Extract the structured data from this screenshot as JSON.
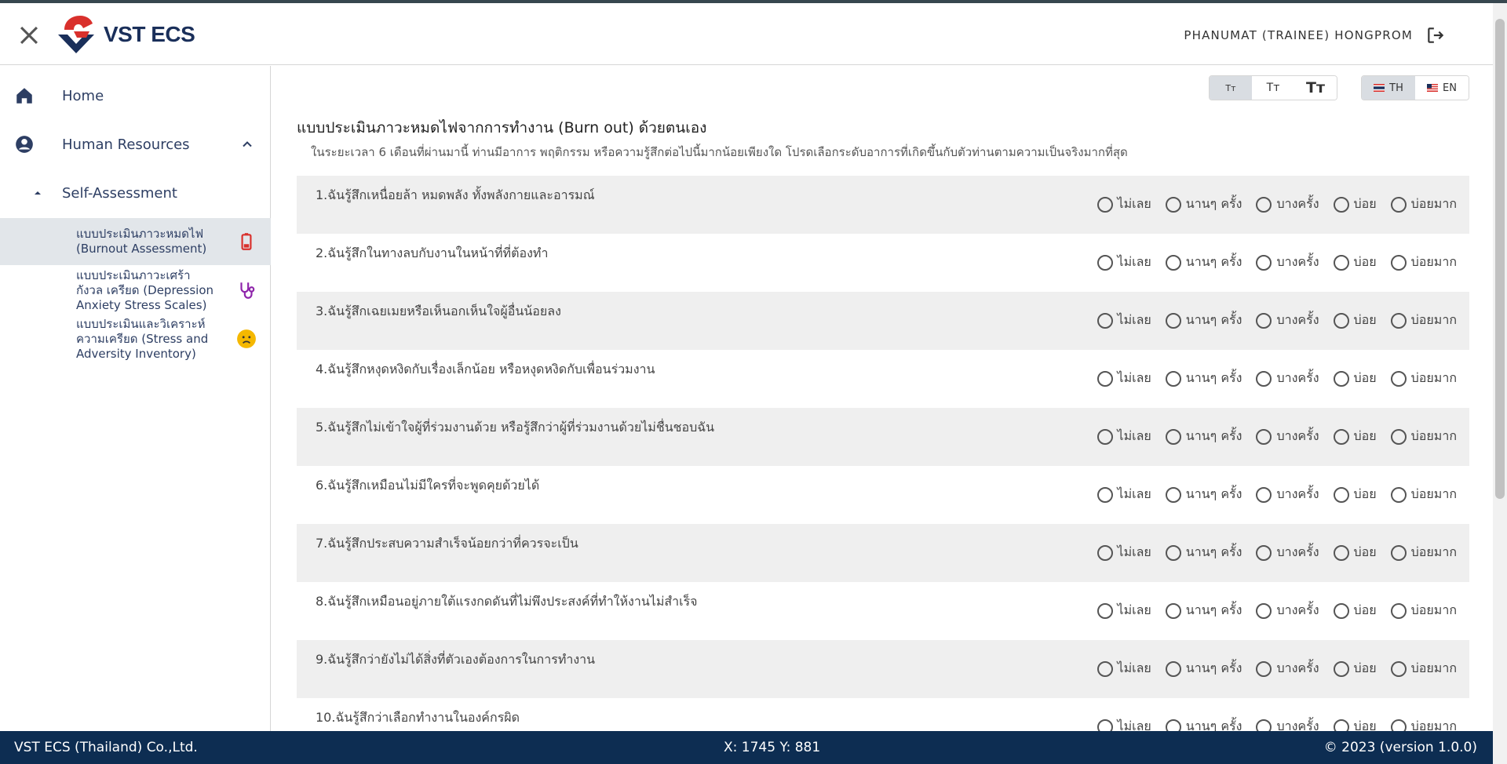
{
  "header": {
    "logo_text": "VST ECS",
    "user_name": "PHANUMAT (TRAINEE) HONGPROM"
  },
  "sidebar": {
    "home": "Home",
    "hr": "Human Resources",
    "self_assessment": "Self-Assessment",
    "items": [
      {
        "label": "แบบประเมินภาวะหมดไฟ (Burnout Assessment)",
        "icon": "battery-low-icon"
      },
      {
        "label": "แบบประเมินภาวะเศร้า กังวล เครียด (Depression Anxiety Stress Scales)",
        "icon": "stethoscope-icon"
      },
      {
        "label": "แบบประเมินและวิเคราะห์ความเครียด (Stress and Adversity Inventory)",
        "icon": "sad-face-icon"
      }
    ]
  },
  "toolbar": {
    "font_sizes": [
      "Tт",
      "Tт",
      "Tт"
    ],
    "lang_th": "TH",
    "lang_en": "EN"
  },
  "main": {
    "title": "แบบประเมินภาวะหมดไฟจากการทำงาน (Burn out) ด้วยตนเอง",
    "subtitle": "ในระยะเวลา 6 เดือนที่ผ่านมานี้ ท่านมีอาการ พฤติกรรม หรือความรู้สึกต่อไปนี้มากน้อยเพียงใด โปรดเลือกระดับอาการที่เกิดขึ้นกับตัวท่านตามความเป็นจริงมากที่สุด",
    "options": [
      "ไม่เลย",
      "นานๆ ครั้ง",
      "บางครั้ง",
      "บ่อย",
      "บ่อยมาก"
    ],
    "questions": [
      "1.ฉันรู้สึกเหนื่อยล้า หมดพลัง ทั้งพลังกายและอารมณ์",
      "2.ฉันรู้สึกในทางลบกับงานในหน้าที่ที่ต้องทำ",
      "3.ฉันรู้สึกเฉยเมยหรือเห็นอกเห็นใจผู้อื่นน้อยลง",
      "4.ฉันรู้สึกหงุดหงิดกับเรื่องเล็กน้อย หรือหงุดหงิดกับเพื่อนร่วมงาน",
      "5.ฉันรู้สึกไม่เข้าใจผู้ที่ร่วมงานด้วย หรือรู้สึกว่าผู้ที่ร่วมงานด้วยไม่ชื่นชอบฉัน",
      "6.ฉันรู้สึกเหมือนไม่มีใครที่จะพูดคุยด้วยได้",
      "7.ฉันรู้สึกประสบความสำเร็จน้อยกว่าที่ควรจะเป็น",
      "8.ฉันรู้สึกเหมือนอยู่ภายใต้แรงกดดันที่ไม่พึงประสงค์ที่ทำให้งานไม่สำเร็จ",
      "9.ฉันรู้สึกว่ายังไม่ได้สิ่งที่ตัวเองต้องการในการทำงาน",
      "10.ฉันรู้สึกว่าเลือกทำงานในองค์กรผิด"
    ]
  },
  "footer": {
    "company": "VST ECS (Thailand) Co.,Ltd.",
    "coords": "X: 1745 Y: 881",
    "version": "© 2023 (version 1.0.0)"
  },
  "colors": {
    "footer_bg": "#0d2d52",
    "brand_red": "#d9302c",
    "brand_navy": "#1a2f5a",
    "active_bg": "#e2e6ea"
  }
}
